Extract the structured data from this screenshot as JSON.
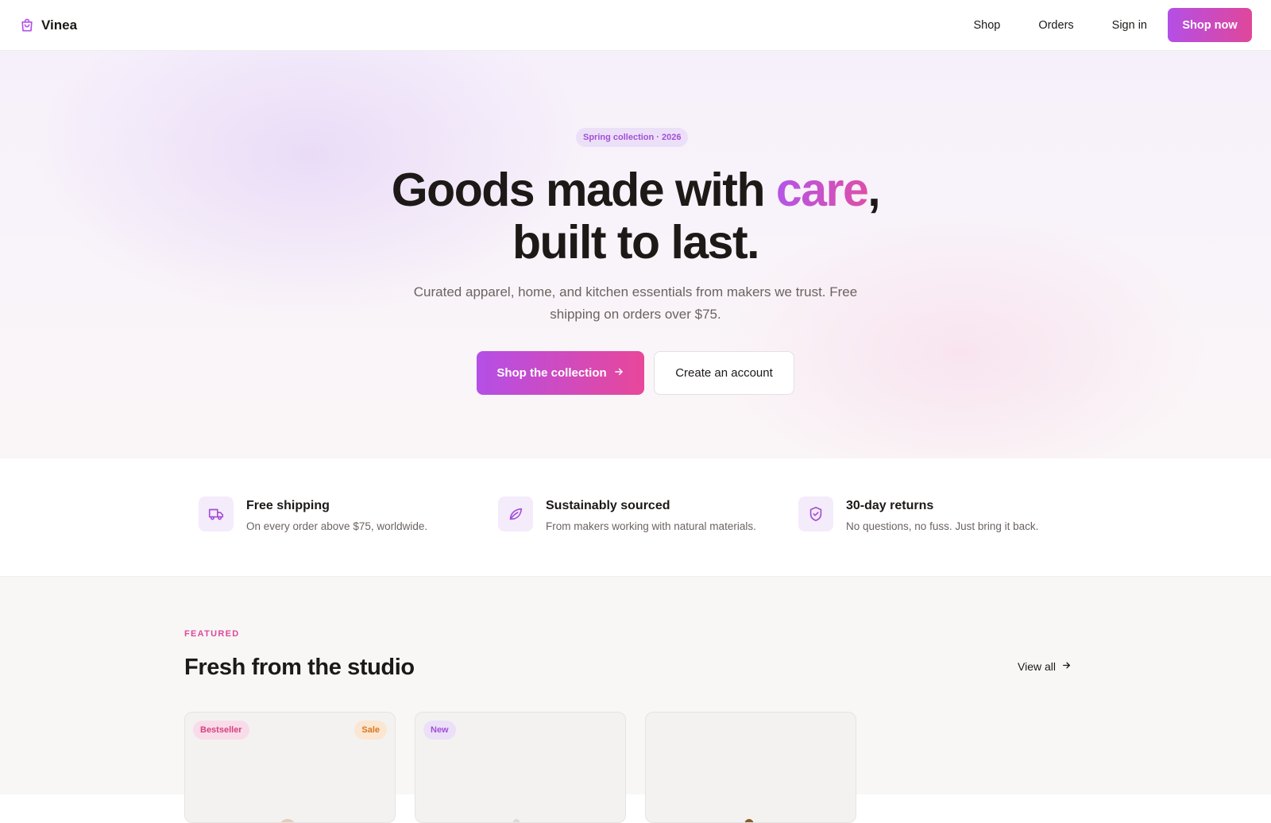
{
  "nav": {
    "brand": "Vinea",
    "links": [
      "Shop",
      "Orders",
      "Sign in"
    ],
    "cta": "Shop now"
  },
  "hero": {
    "pill": "Spring collection · 2026",
    "headline_pre": "Goods made with ",
    "headline_accent": "care",
    "headline_post": ",",
    "headline_line2": "built to last.",
    "subtext": "Curated apparel, home, and kitchen essentials from makers we trust. Free shipping on orders over $75.",
    "primary_cta": "Shop the collection",
    "secondary_cta": "Create an account"
  },
  "features": [
    {
      "icon": "truck-icon",
      "title": "Free shipping",
      "desc": "On every order above $75, worldwide."
    },
    {
      "icon": "leaf-icon",
      "title": "Sustainably sourced",
      "desc": "From makers working with natural materials."
    },
    {
      "icon": "shield-check-icon",
      "title": "30-day returns",
      "desc": "No questions, no fuss. Just bring it back."
    }
  ],
  "featured": {
    "eyebrow": "FEATURED",
    "title": "Fresh from the studio",
    "view_all": "View all",
    "cards": [
      {
        "badges": [
          "Bestseller",
          "Sale"
        ]
      },
      {
        "badges": [
          "New"
        ]
      },
      {
        "badges": []
      }
    ]
  },
  "colors": {
    "accent_purple": "#b44fe6",
    "accent_pink": "#e0479a",
    "text": "#1c1917",
    "muted": "#6b6360"
  }
}
